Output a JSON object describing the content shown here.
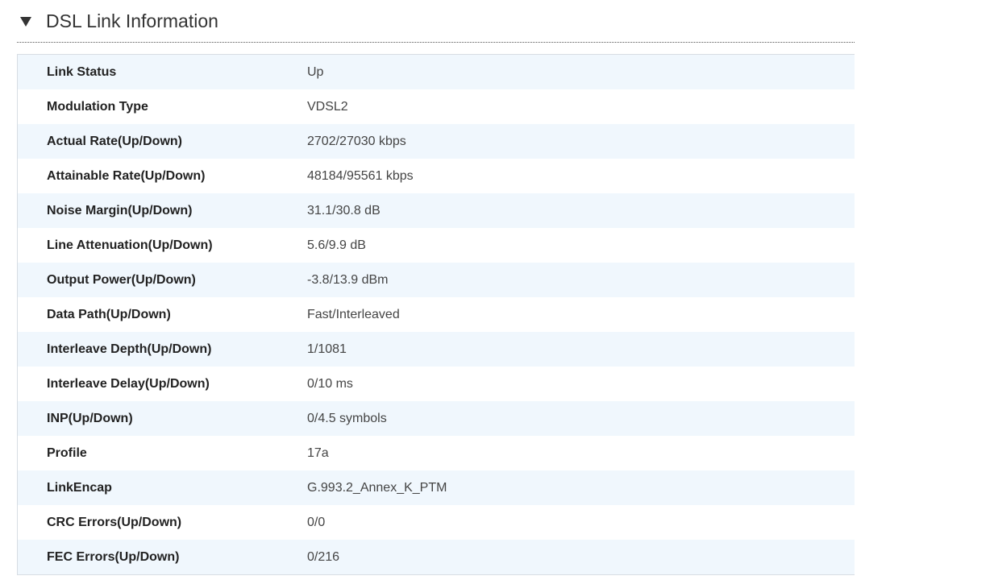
{
  "section": {
    "title": "DSL Link Information",
    "toggle_icon": "triangle-down-icon"
  },
  "rows": [
    {
      "label": "Link Status",
      "value": "Up"
    },
    {
      "label": "Modulation Type",
      "value": "VDSL2"
    },
    {
      "label": "Actual Rate(Up/Down)",
      "value": "2702/27030 kbps"
    },
    {
      "label": "Attainable Rate(Up/Down)",
      "value": "48184/95561 kbps"
    },
    {
      "label": "Noise Margin(Up/Down)",
      "value": "31.1/30.8 dB"
    },
    {
      "label": "Line Attenuation(Up/Down)",
      "value": "5.6/9.9 dB"
    },
    {
      "label": "Output Power(Up/Down)",
      "value": "-3.8/13.9 dBm"
    },
    {
      "label": "Data Path(Up/Down)",
      "value": "Fast/Interleaved"
    },
    {
      "label": "Interleave Depth(Up/Down)",
      "value": "1/1081"
    },
    {
      "label": "Interleave Delay(Up/Down)",
      "value": "0/10 ms"
    },
    {
      "label": "INP(Up/Down)",
      "value": "0/4.5 symbols"
    },
    {
      "label": "Profile",
      "value": "17a"
    },
    {
      "label": "LinkEncap",
      "value": "G.993.2_Annex_K_PTM"
    },
    {
      "label": "CRC Errors(Up/Down)",
      "value": "0/0"
    },
    {
      "label": "FEC Errors(Up/Down)",
      "value": "0/216"
    }
  ],
  "colors": {
    "stripe": "#f0f7fd",
    "border": "#d7dde3",
    "text": "#333333"
  }
}
